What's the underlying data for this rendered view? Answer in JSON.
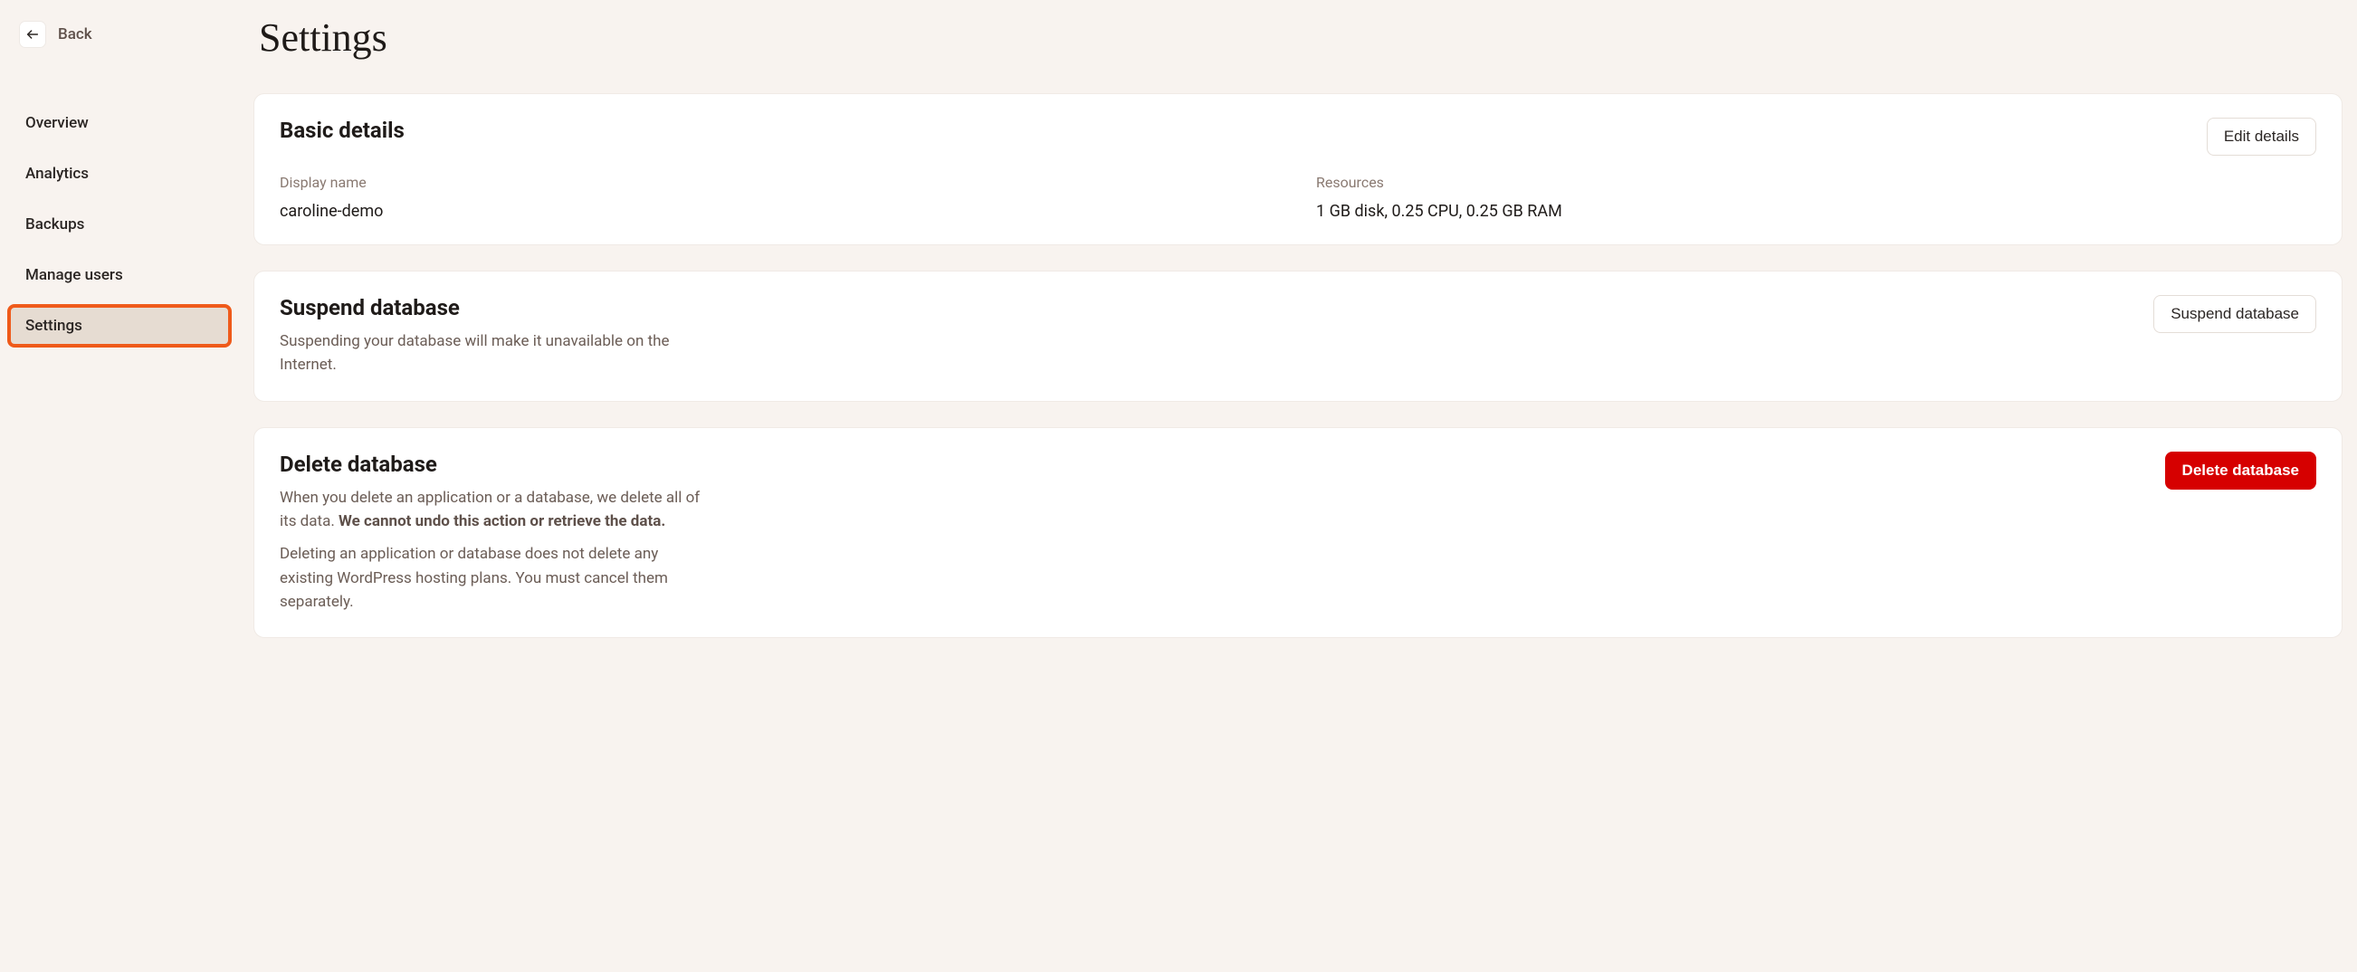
{
  "sidebar": {
    "back_label": "Back",
    "items": [
      {
        "label": "Overview",
        "active": false
      },
      {
        "label": "Analytics",
        "active": false
      },
      {
        "label": "Backups",
        "active": false
      },
      {
        "label": "Manage users",
        "active": false
      },
      {
        "label": "Settings",
        "active": true
      }
    ]
  },
  "page": {
    "title": "Settings"
  },
  "basic_details": {
    "title": "Basic details",
    "edit_button": "Edit details",
    "display_name_label": "Display name",
    "display_name_value": "caroline-demo",
    "resources_label": "Resources",
    "resources_value": "1 GB disk, 0.25 CPU, 0.25 GB RAM"
  },
  "suspend": {
    "title": "Suspend database",
    "description": "Suspending your database will make it unavailable on the Internet.",
    "button": "Suspend database"
  },
  "delete": {
    "title": "Delete database",
    "p1_a": "When you delete an application or a database, we delete all of its data. ",
    "p1_b": "We cannot undo this action or retrieve the data.",
    "p2": "Deleting an application or database does not delete any existing WordPress hosting plans. You must cancel them separately.",
    "button": "Delete database"
  }
}
